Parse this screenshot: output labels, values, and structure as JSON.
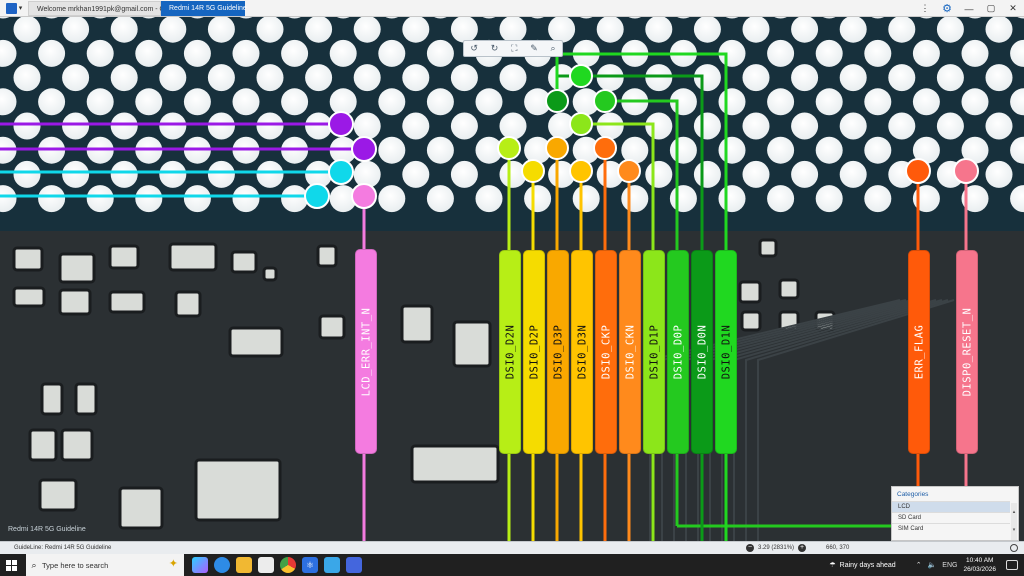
{
  "window": {
    "tabs": [
      {
        "label": "Welcome mrkhan1991pk@gmail.com - Orion"
      },
      {
        "label": "Redmi 14R 5G Guideline"
      }
    ],
    "controls": [
      "⋮",
      "⚙",
      "—",
      "▢",
      "✕"
    ]
  },
  "toolbar": {
    "icons": [
      "rotate-left-icon",
      "rotate-right-icon",
      "fit-screen-icon",
      "brush-icon",
      "search-icon"
    ],
    "glyphs": [
      "↺",
      "↻",
      "⛶",
      "✎",
      "⌕"
    ]
  },
  "colors": {
    "purple": "#9b19e6",
    "cyan": "#10d8ea",
    "pink": "#f47be0",
    "lime": "#b7ee16",
    "yellow": "#f5dc00",
    "orange": "#f9a800",
    "amber": "#ffc400",
    "red_orange": "#ff6d0c",
    "bright_green": "#8ce61a",
    "green": "#24c91f",
    "dark_green": "#0b9a18",
    "bg_green": "#20d820",
    "rose": "#f6758c"
  },
  "guidelines": [
    {
      "label": "LCD_ERR_INT_N",
      "color": "#f47be0",
      "text_color": "#ffffff"
    },
    {
      "label": "DSI0_D2N",
      "color": "#b7ee16",
      "text_color": "#111111"
    },
    {
      "label": "DSI0_D2P",
      "color": "#f5dc00",
      "text_color": "#111111"
    },
    {
      "label": "DSI0_D3P",
      "color": "#f9a800",
      "text_color": "#111111"
    },
    {
      "label": "DSI0_D3N",
      "color": "#ffc400",
      "text_color": "#111111"
    },
    {
      "label": "DSI0_CKP",
      "color": "#ff6d0c",
      "text_color": "#ffffff"
    },
    {
      "label": "DSI0_CKN",
      "color": "#ff8a1c",
      "text_color": "#ffffff"
    },
    {
      "label": "DSI0_D1P",
      "color": "#8ce61a",
      "text_color": "#111111"
    },
    {
      "label": "DSI0_D0P",
      "color": "#24c91f",
      "text_color": "#ffffff"
    },
    {
      "label": "DSI0_D0N",
      "color": "#0b9a18",
      "text_color": "#ffffff"
    },
    {
      "label": "DSI0_D1N",
      "color": "#20d820",
      "text_color": "#111111"
    },
    {
      "label": "ERR_FLAG",
      "color": "#ff5a0a",
      "text_color": "#ffffff"
    },
    {
      "label": "DISP0_RESET_N",
      "color": "#f6758c",
      "text_color": "#ffffff"
    }
  ],
  "categories": {
    "title": "Categories",
    "items": [
      "LCD",
      "SD Card",
      "SIM Card"
    ],
    "selected": "LCD"
  },
  "watermark": "Redmi 14R 5G Guideline",
  "status": {
    "guideline": "GuideLine: Redmi 14R 5G Guideline",
    "zoom": "3.29 (2831%)",
    "coords": "660, 370"
  },
  "taskbar": {
    "search_placeholder": "Type here to search",
    "weather": "Rainy days ahead",
    "language": "ENG",
    "time": "10:40 AM",
    "date": "26/03/2026"
  }
}
